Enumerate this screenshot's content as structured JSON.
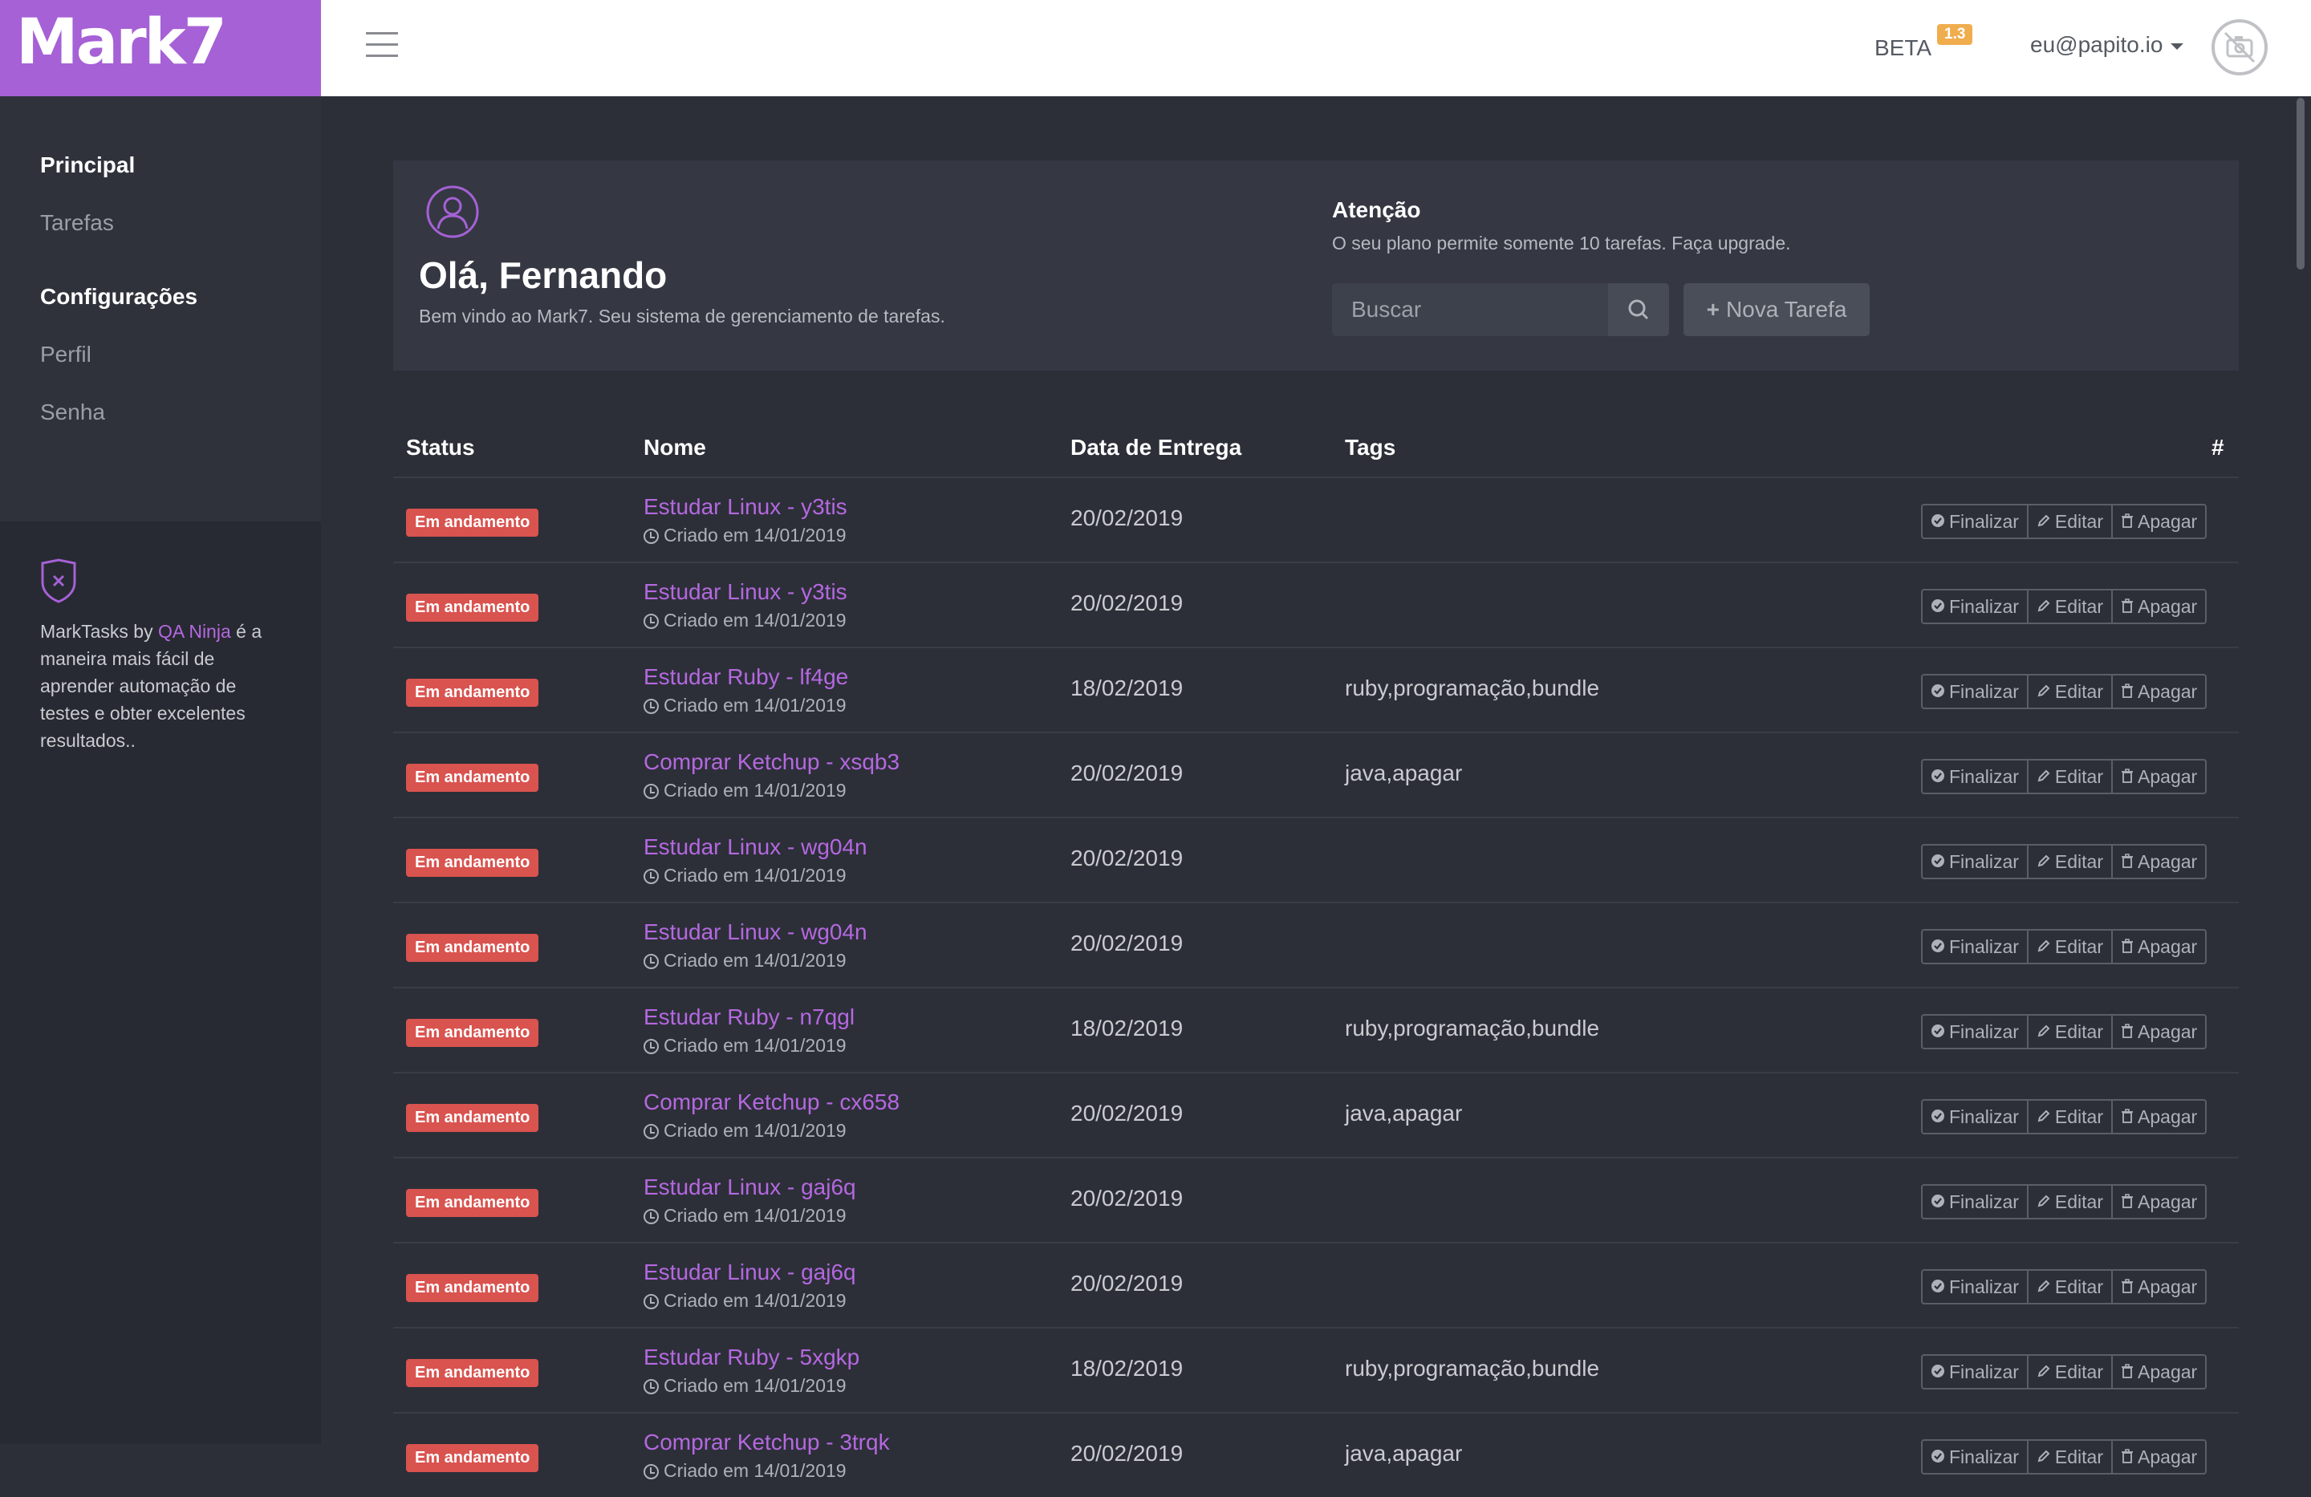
{
  "header": {
    "logo": "Mark7",
    "beta": "BETA",
    "version": "1.3",
    "user_email": "eu@papito.io"
  },
  "sidebar": {
    "principal_heading": "Principal",
    "principal_items": [
      "Tarefas"
    ],
    "config_heading": "Configurações",
    "config_items": [
      "Perfil",
      "Senha"
    ],
    "promo": {
      "prefix": "MarkTasks by ",
      "link": "QA Ninja",
      "suffix": " é a maneira mais fácil de aprender automação de testes e obter excelentes resultados.."
    }
  },
  "welcome": {
    "greeting": "Olá, Fernando",
    "subtitle": "Bem vindo ao Mark7. Seu sistema de gerenciamento de tarefas."
  },
  "attention": {
    "title": "Atenção",
    "text": "O seu plano permite somente 10 tarefas. Faça upgrade."
  },
  "search": {
    "placeholder": "Buscar"
  },
  "new_task_label": "Nova Tarefa",
  "table": {
    "headers": {
      "status": "Status",
      "name": "Nome",
      "due": "Data de Entrega",
      "tags": "Tags",
      "hash": "#"
    },
    "actions": {
      "finish": "Finalizar",
      "edit": "Editar",
      "delete": "Apagar"
    },
    "rows": [
      {
        "status": "Em andamento",
        "name": "Estudar Linux - y3tis",
        "created": "Criado em 14/01/2019",
        "due": "20/02/2019",
        "tags": ""
      },
      {
        "status": "Em andamento",
        "name": "Estudar Linux - y3tis",
        "created": "Criado em 14/01/2019",
        "due": "20/02/2019",
        "tags": ""
      },
      {
        "status": "Em andamento",
        "name": "Estudar Ruby - lf4ge",
        "created": "Criado em 14/01/2019",
        "due": "18/02/2019",
        "tags": "ruby,programação,bundle"
      },
      {
        "status": "Em andamento",
        "name": "Comprar Ketchup - xsqb3",
        "created": "Criado em 14/01/2019",
        "due": "20/02/2019",
        "tags": "java,apagar"
      },
      {
        "status": "Em andamento",
        "name": "Estudar Linux - wg04n",
        "created": "Criado em 14/01/2019",
        "due": "20/02/2019",
        "tags": ""
      },
      {
        "status": "Em andamento",
        "name": "Estudar Linux - wg04n",
        "created": "Criado em 14/01/2019",
        "due": "20/02/2019",
        "tags": ""
      },
      {
        "status": "Em andamento",
        "name": "Estudar Ruby - n7qgl",
        "created": "Criado em 14/01/2019",
        "due": "18/02/2019",
        "tags": "ruby,programação,bundle"
      },
      {
        "status": "Em andamento",
        "name": "Comprar Ketchup - cx658",
        "created": "Criado em 14/01/2019",
        "due": "20/02/2019",
        "tags": "java,apagar"
      },
      {
        "status": "Em andamento",
        "name": "Estudar Linux - gaj6q",
        "created": "Criado em 14/01/2019",
        "due": "20/02/2019",
        "tags": ""
      },
      {
        "status": "Em andamento",
        "name": "Estudar Linux - gaj6q",
        "created": "Criado em 14/01/2019",
        "due": "20/02/2019",
        "tags": ""
      },
      {
        "status": "Em andamento",
        "name": "Estudar Ruby - 5xgkp",
        "created": "Criado em 14/01/2019",
        "due": "18/02/2019",
        "tags": "ruby,programação,bundle"
      },
      {
        "status": "Em andamento",
        "name": "Comprar Ketchup - 3trqk",
        "created": "Criado em 14/01/2019",
        "due": "20/02/2019",
        "tags": "java,apagar"
      }
    ]
  }
}
